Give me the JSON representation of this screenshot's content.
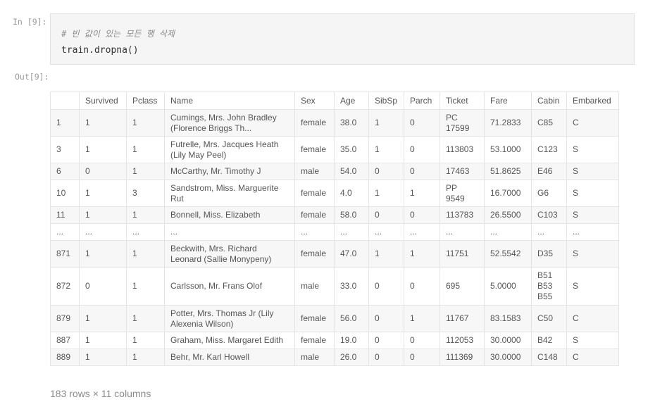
{
  "input_prompt": "In [9]:",
  "output_prompt": "Out[9]:",
  "code": {
    "comment": "# 빈 값이 있는 모든 행 삭제",
    "line": "train.dropna()"
  },
  "table": {
    "columns": [
      "",
      "Survived",
      "Pclass",
      "Name",
      "Sex",
      "Age",
      "SibSp",
      "Parch",
      "Ticket",
      "Fare",
      "Cabin",
      "Embarked"
    ],
    "rows": [
      {
        "h": 38,
        "cells": [
          "1",
          "1",
          "1",
          "Cumings, Mrs. John Bradley\n(Florence Briggs Th...",
          "female",
          "38.0",
          "1",
          "0",
          "PC\n17599",
          "71.2833",
          "C85",
          "C"
        ]
      },
      {
        "h": 38,
        "cells": [
          "3",
          "1",
          "1",
          "Futrelle, Mrs. Jacques Heath\n(Lily May Peel)",
          "female",
          "35.0",
          "1",
          "0",
          "113803",
          "53.1000",
          "C123",
          "S"
        ]
      },
      {
        "h": 24,
        "cells": [
          "6",
          "0",
          "1",
          "McCarthy, Mr. Timothy J",
          "male",
          "54.0",
          "0",
          "0",
          "17463",
          "51.8625",
          "E46",
          "S"
        ]
      },
      {
        "h": 38,
        "cells": [
          "10",
          "1",
          "3",
          "Sandstrom, Miss. Marguerite\nRut",
          "female",
          "4.0",
          "1",
          "1",
          "PP\n9549",
          "16.7000",
          "G6",
          "S"
        ]
      },
      {
        "h": 24,
        "cells": [
          "11",
          "1",
          "1",
          "Bonnell, Miss. Elizabeth",
          "female",
          "58.0",
          "0",
          "0",
          "113783",
          "26.5500",
          "C103",
          "S"
        ]
      },
      {
        "h": 24,
        "cells": [
          "...",
          "...",
          "...",
          "...",
          "...",
          "...",
          "...",
          "...",
          "...",
          "...",
          "...",
          "..."
        ]
      },
      {
        "h": 38,
        "cells": [
          "871",
          "1",
          "1",
          "Beckwith, Mrs. Richard\nLeonard (Sallie Monypeny)",
          "female",
          "47.0",
          "1",
          "1",
          "11751",
          "52.5542",
          "D35",
          "S"
        ]
      },
      {
        "h": 54,
        "cells": [
          "872",
          "0",
          "1",
          "Carlsson, Mr. Frans Olof",
          "male",
          "33.0",
          "0",
          "0",
          "695",
          "5.0000",
          "B51\nB53\nB55",
          "S"
        ]
      },
      {
        "h": 38,
        "cells": [
          "879",
          "1",
          "1",
          "Potter, Mrs. Thomas Jr (Lily\nAlexenia Wilson)",
          "female",
          "56.0",
          "0",
          "1",
          "11767",
          "83.1583",
          "C50",
          "C"
        ]
      },
      {
        "h": 24,
        "cells": [
          "887",
          "1",
          "1",
          "Graham, Miss. Margaret Edith",
          "female",
          "19.0",
          "0",
          "0",
          "112053",
          "30.0000",
          "B42",
          "S"
        ]
      },
      {
        "h": 24,
        "cells": [
          "889",
          "1",
          "1",
          "Behr, Mr. Karl Howell",
          "male",
          "26.0",
          "0",
          "0",
          "111369",
          "30.0000",
          "C148",
          "C"
        ]
      }
    ]
  },
  "footer": "183 rows × 11 columns"
}
